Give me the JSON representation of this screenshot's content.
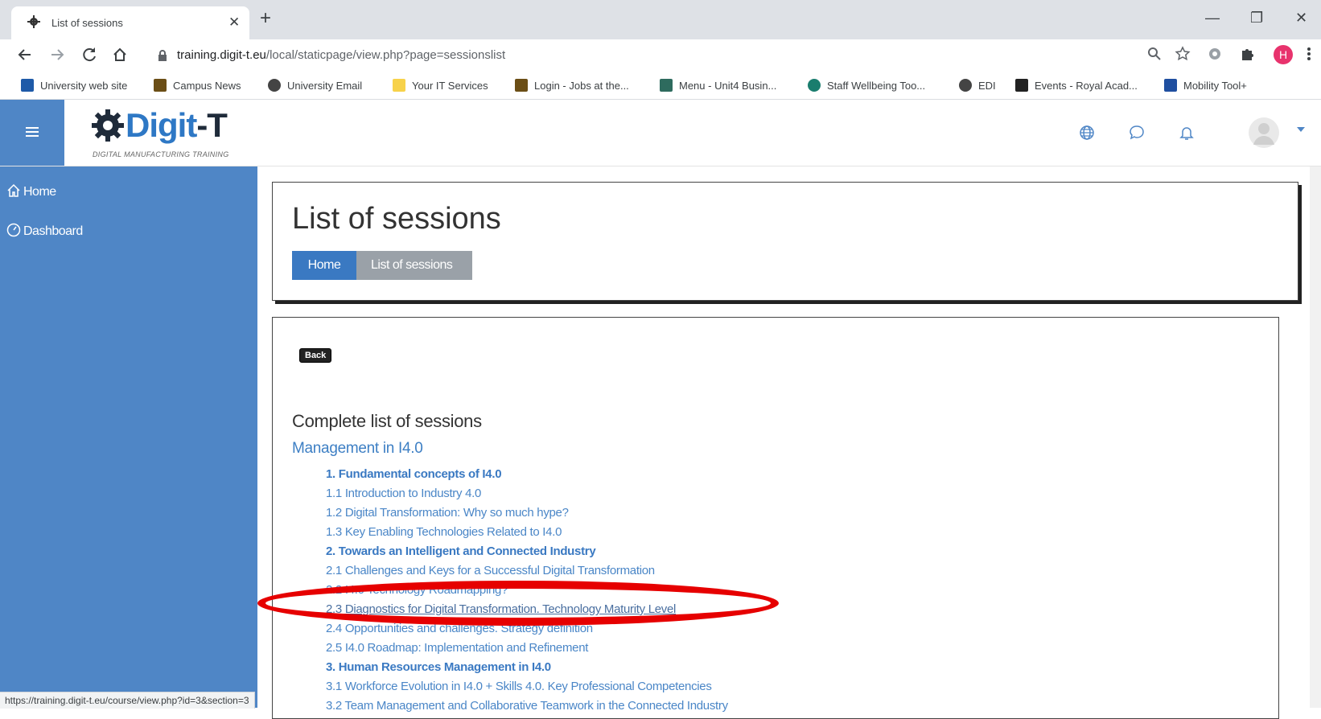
{
  "browser": {
    "tab": {
      "title": "List of sessions",
      "close": "✕"
    },
    "new_tab": "+",
    "window_controls": {
      "minimize": "—",
      "restore": "❐",
      "close": "✕"
    },
    "url": {
      "host": "training.digit-t.eu",
      "path": "/local/staticpage/view.php?page=sessionslist"
    },
    "profile_initial": "H",
    "bookmarks": [
      {
        "label": "University web site",
        "color": "#1e5aa8"
      },
      {
        "label": "Campus News",
        "color": "#6b4e16"
      },
      {
        "label": "University Email",
        "color": "#444444"
      },
      {
        "label": "Your IT Services",
        "color": "#f7d24a"
      },
      {
        "label": "Login - Jobs at the...",
        "color": "#6b4e16"
      },
      {
        "label": "Menu - Unit4 Busin...",
        "color": "#2e6b5e"
      },
      {
        "label": "Staff Wellbeing Too...",
        "color": "#1a7d6e"
      },
      {
        "label": "EDI",
        "color": "#444444"
      },
      {
        "label": "Events - Royal Acad...",
        "color": "#222222"
      },
      {
        "label": "Mobility Tool+",
        "color": "#1f4fa0"
      }
    ],
    "status_url": "https://training.digit-t.eu/course/view.php?id=3&section=3"
  },
  "header": {
    "brand": {
      "digit": "Digit",
      "t": "-T"
    },
    "tagline": "DIGITAL MANUFACTURING TRAINING"
  },
  "drawer": {
    "items": [
      {
        "label": "Home"
      },
      {
        "label": "Dashboard"
      }
    ]
  },
  "page": {
    "title": "List of sessions",
    "breadcrumb": [
      "Home",
      "List of sessions"
    ],
    "back": "Back",
    "heading": "Complete list of sessions",
    "module": "Management in I4.0",
    "sessions": [
      {
        "label": "1. Fundamental concepts of I4.0",
        "type": "section"
      },
      {
        "label": "1.1 Introduction to Industry 4.0",
        "type": "item"
      },
      {
        "label": "1.2 Digital Transformation: Why so much hype?",
        "type": "item"
      },
      {
        "label": "1.3 Key Enabling Technologies Related to I4.0",
        "type": "item"
      },
      {
        "label": "2. Towards an Intelligent and Connected Industry",
        "type": "section"
      },
      {
        "label": "2.1 Challenges and Keys for a Successful Digital Transformation",
        "type": "item"
      },
      {
        "label": "2.2 I4.0 Technology Roadmapping?",
        "type": "item"
      },
      {
        "label": "2.3 Diagnostics for Digital Transformation. Technology Maturity Level",
        "type": "item",
        "hover": true
      },
      {
        "label": "2.4 Opportunities and challenges. Strategy definition",
        "type": "item"
      },
      {
        "label": "2.5 I4.0 Roadmap: Implementation and Refinement",
        "type": "item"
      },
      {
        "label": "3. Human Resources Management in I4.0",
        "type": "section"
      },
      {
        "label": "3.1 Workforce Evolution in I4.0 + Skills 4.0. Key Professional Competencies",
        "type": "item"
      },
      {
        "label": "3.2 Team Management and Collaborative Teamwork in the Connected Industry",
        "type": "item"
      }
    ]
  },
  "colors": {
    "drawer": "#4f86c6",
    "link": "#4a86c7",
    "annotation": "#e60000"
  }
}
